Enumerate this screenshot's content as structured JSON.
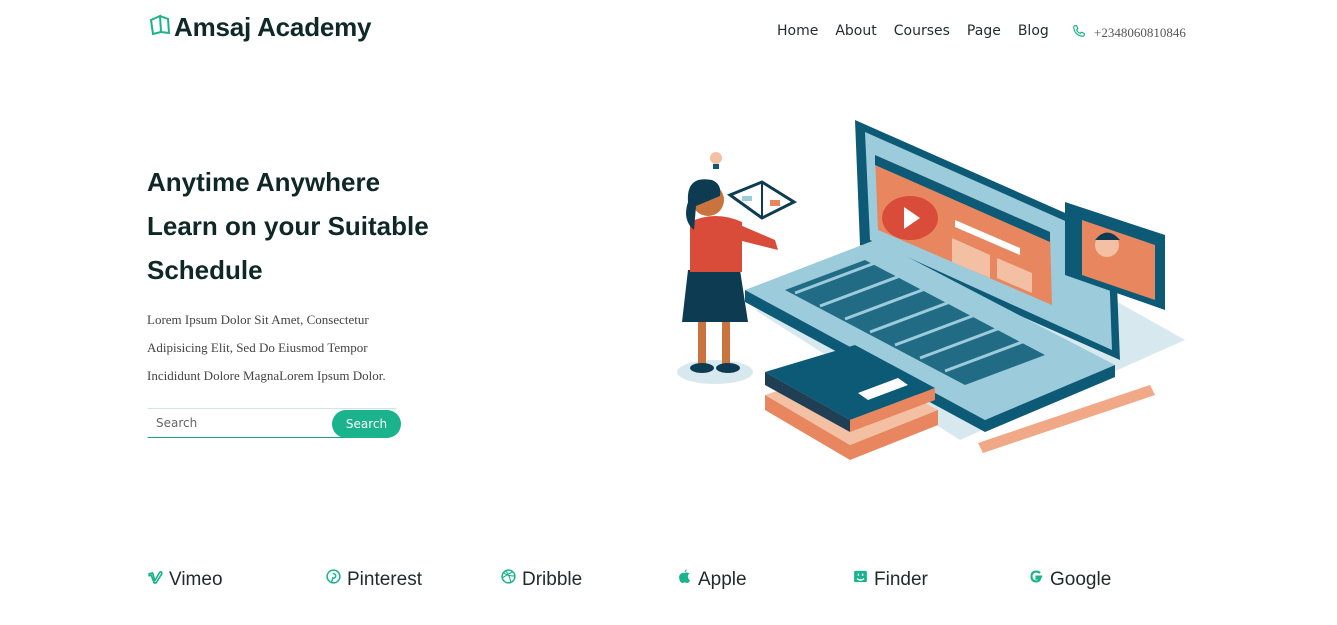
{
  "header": {
    "brand": "Amsaj Academy",
    "nav": [
      "Home",
      "About",
      "Courses",
      "Page",
      "Blog"
    ],
    "phone": "+2348060810846"
  },
  "hero": {
    "title_lines": [
      "Anytime Anywhere",
      "Learn on your Suitable",
      "Schedule"
    ],
    "description_lines": [
      "Lorem Ipsum Dolor Sit Amet, Consectetur",
      "Adipisicing Elit, Sed Do Eiusmod Tempor",
      "Incididunt Dolore MagnaLorem Ipsum Dolor."
    ],
    "search": {
      "placeholder": "Search",
      "button_label": "Search"
    }
  },
  "brands": [
    "Vimeo",
    "Pinterest",
    "Dribble",
    "Apple",
    "Finder",
    "Google"
  ],
  "colors": {
    "accent": "#1ab38c",
    "dark_teal": "#0d5a76",
    "orange": "#e8875f",
    "light_blue": "#9ccbdb"
  }
}
